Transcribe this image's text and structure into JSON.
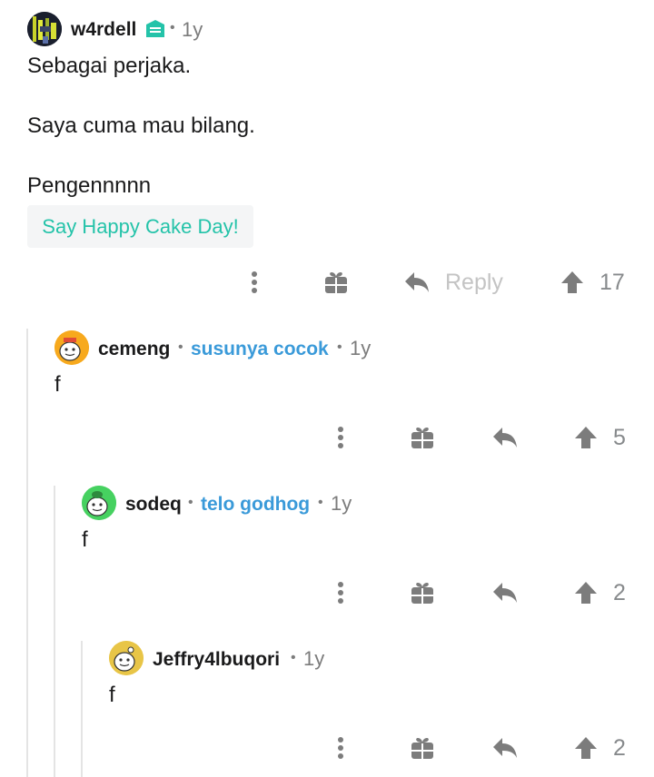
{
  "comments": [
    {
      "author": "w4rdell",
      "age": "1y",
      "lines": [
        "Sebagai perjaka.",
        "Saya cuma mau bilang.",
        "Pengennnnn"
      ],
      "cake_day_button": "Say Happy Cake Day!",
      "reply_label": "Reply",
      "votes": "17"
    },
    {
      "author": "cemeng",
      "flair": "susunya cocok",
      "age": "1y",
      "text": "f",
      "votes": "5"
    },
    {
      "author": "sodeq",
      "flair": "telo godhog",
      "age": "1y",
      "text": "f",
      "votes": "2"
    },
    {
      "author": "Jeffry4lbuqori",
      "age": "1y",
      "text": "f",
      "votes": "2"
    }
  ],
  "separator": "•",
  "colors": {
    "accent_teal": "#24c3a9",
    "flair_blue": "#3a9ad9",
    "icon_gray": "#7c7c7c",
    "thread_line": "#e4e4e4"
  },
  "icons": [
    "more-vertical-icon",
    "gift-icon",
    "reply-icon",
    "upvote-icon",
    "moderator-badge-icon"
  ]
}
